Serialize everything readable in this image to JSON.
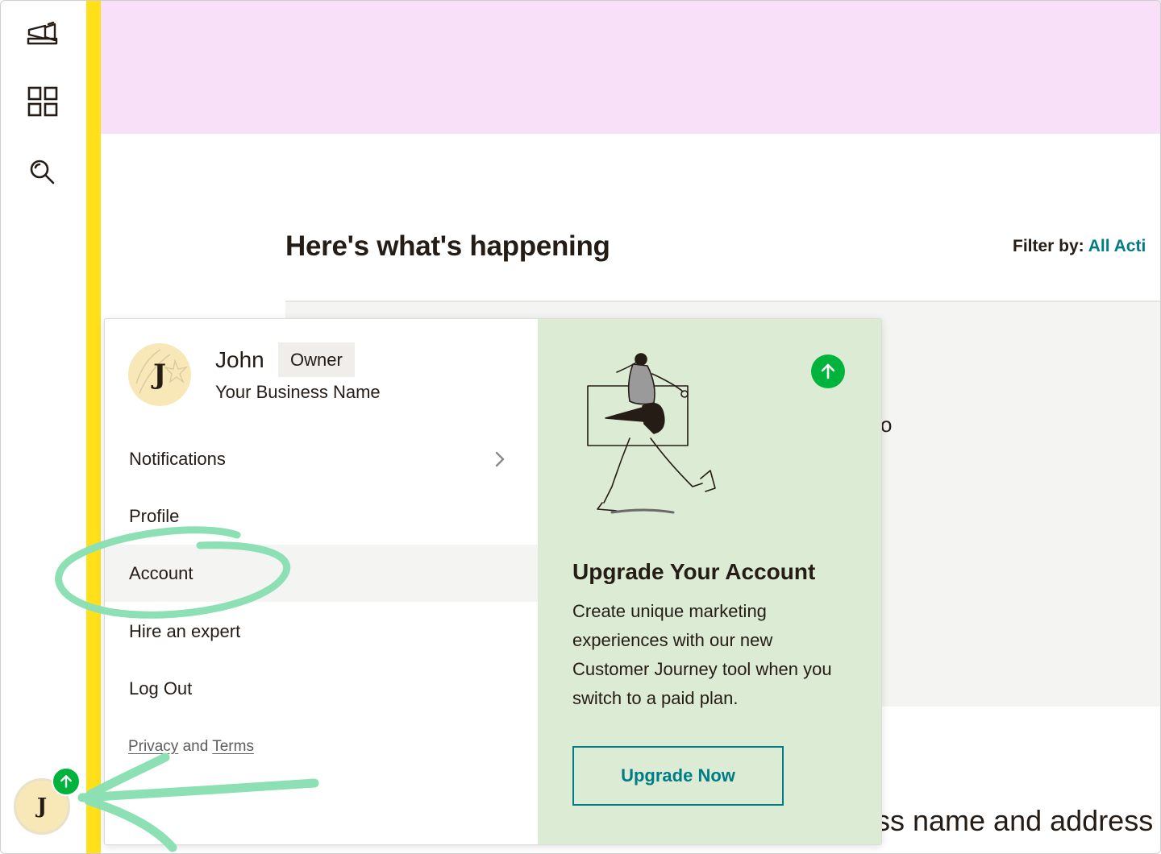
{
  "header": {
    "title": "Here's what's happening",
    "filter_label": "Filter by:",
    "filter_value": "All Acti"
  },
  "background": {
    "peek_glyph": "o",
    "peek_text": "ss name and address"
  },
  "sidebar": {
    "icons": [
      "campaign-icon",
      "grid-icon",
      "search-icon"
    ]
  },
  "account_menu": {
    "avatar_initial": "J",
    "user_name": "John",
    "role": "Owner",
    "business_name": "Your Business Name",
    "items": [
      {
        "label": "Notifications",
        "has_chevron": true
      },
      {
        "label": "Profile"
      },
      {
        "label": "Account",
        "highlighted": true
      },
      {
        "label": "Hire an expert"
      },
      {
        "label": "Log Out"
      }
    ],
    "legal": {
      "privacy": "Privacy",
      "and": "and",
      "terms": "Terms"
    }
  },
  "upgrade": {
    "title": "Upgrade Your Account",
    "description": "Create unique marketing experiences with our new Customer Journey tool when you switch to a paid plan.",
    "button": "Upgrade Now"
  },
  "bottom_avatar": {
    "initial": "J"
  },
  "colors": {
    "accent_yellow": "#ffe01b",
    "banner_pink": "#f8e1f8",
    "teal": "#007c89",
    "green": "#00b33c",
    "panel_green": "#dcebd3",
    "annotation": "#8de0b4"
  }
}
